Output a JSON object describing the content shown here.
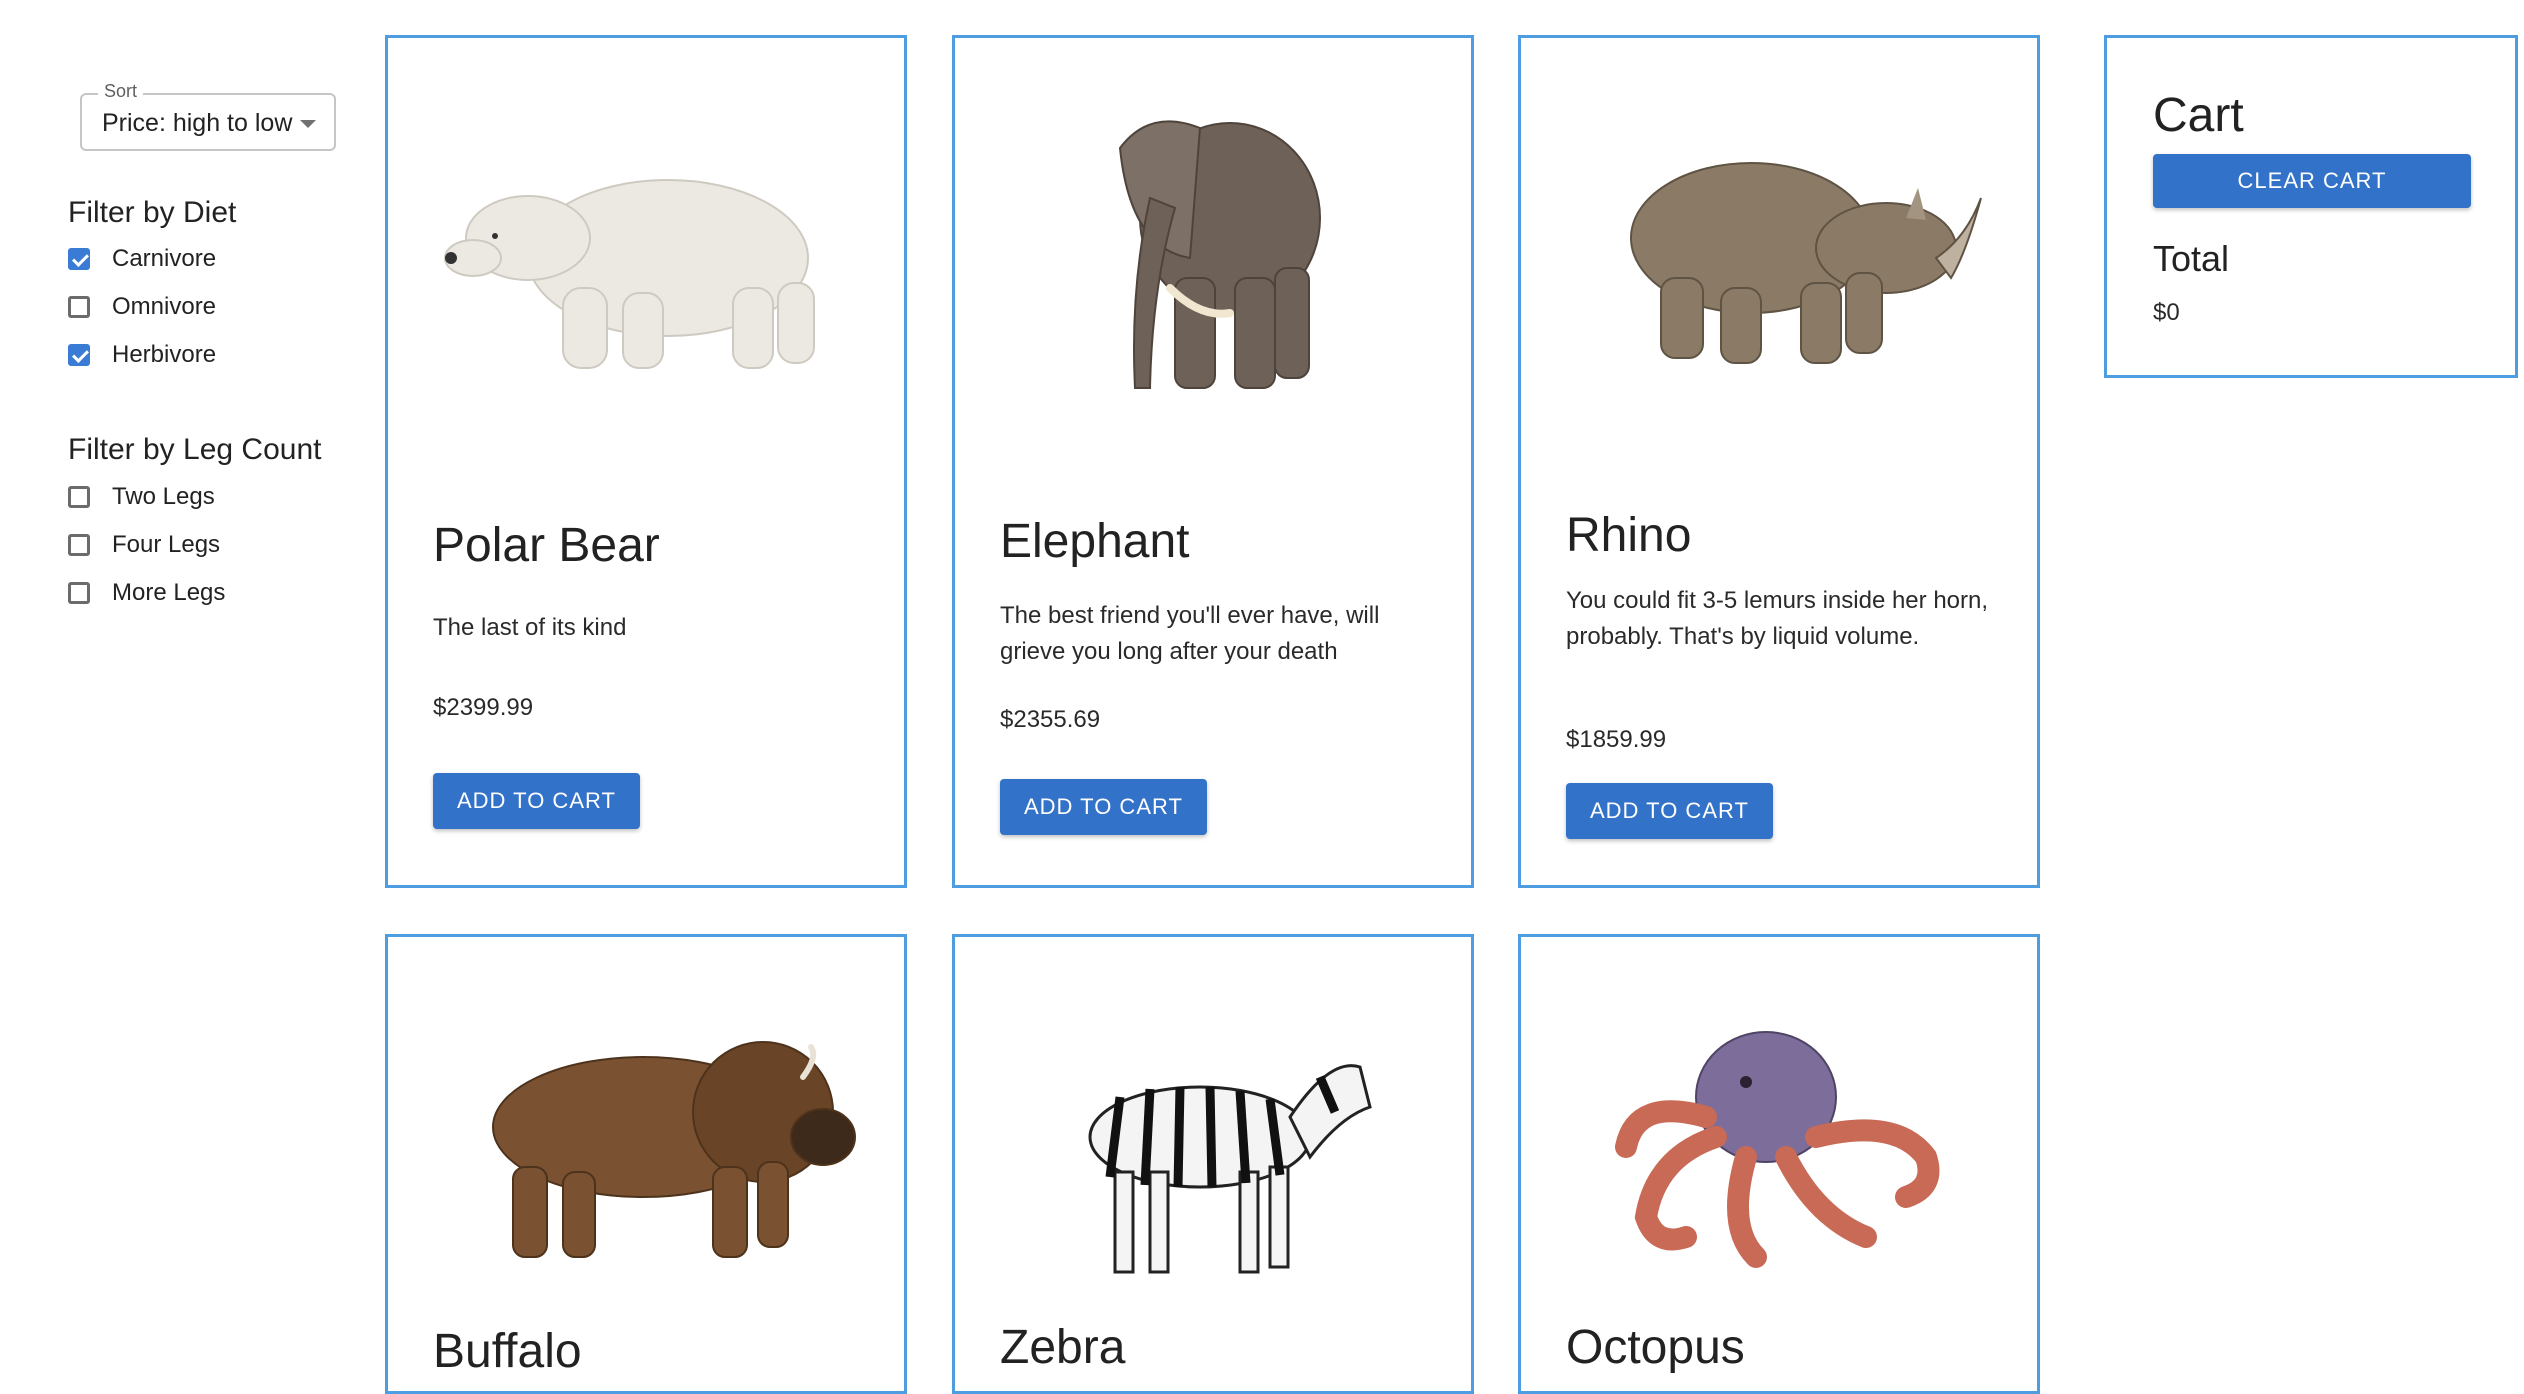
{
  "sidebar": {
    "sort": {
      "legend": "Sort",
      "value": "Price: high to low"
    },
    "diet": {
      "title": "Filter by Diet",
      "options": [
        {
          "label": "Carnivore",
          "checked": true
        },
        {
          "label": "Omnivore",
          "checked": false
        },
        {
          "label": "Herbivore",
          "checked": true
        }
      ]
    },
    "legs": {
      "title": "Filter by Leg Count",
      "options": [
        {
          "label": "Two Legs",
          "checked": false
        },
        {
          "label": "Four Legs",
          "checked": false
        },
        {
          "label": "More Legs",
          "checked": false
        }
      ]
    }
  },
  "products": [
    {
      "name": "Polar Bear",
      "description": "The last of its kind",
      "price": "$2399.99",
      "button": "ADD TO CART",
      "image": "polar-bear"
    },
    {
      "name": "Elephant",
      "description": "The best friend you'll ever have, will grieve you long after your death",
      "price": "$2355.69",
      "button": "ADD TO CART",
      "image": "elephant"
    },
    {
      "name": "Rhino",
      "description": "You could fit 3-5 lemurs inside her horn, probably. That's by liquid volume.",
      "price": "$1859.99",
      "button": "ADD TO CART",
      "image": "rhino"
    },
    {
      "name": "Buffalo",
      "image": "buffalo"
    },
    {
      "name": "Zebra",
      "image": "zebra"
    },
    {
      "name": "Octopus",
      "image": "octopus"
    }
  ],
  "cart": {
    "title": "Cart",
    "clear_label": "CLEAR CART",
    "total_label": "Total",
    "total_value": "$0"
  },
  "colors": {
    "accent": "#3372c9",
    "card_border": "#4d9de0",
    "checkbox_checked": "#3a7bd5"
  }
}
